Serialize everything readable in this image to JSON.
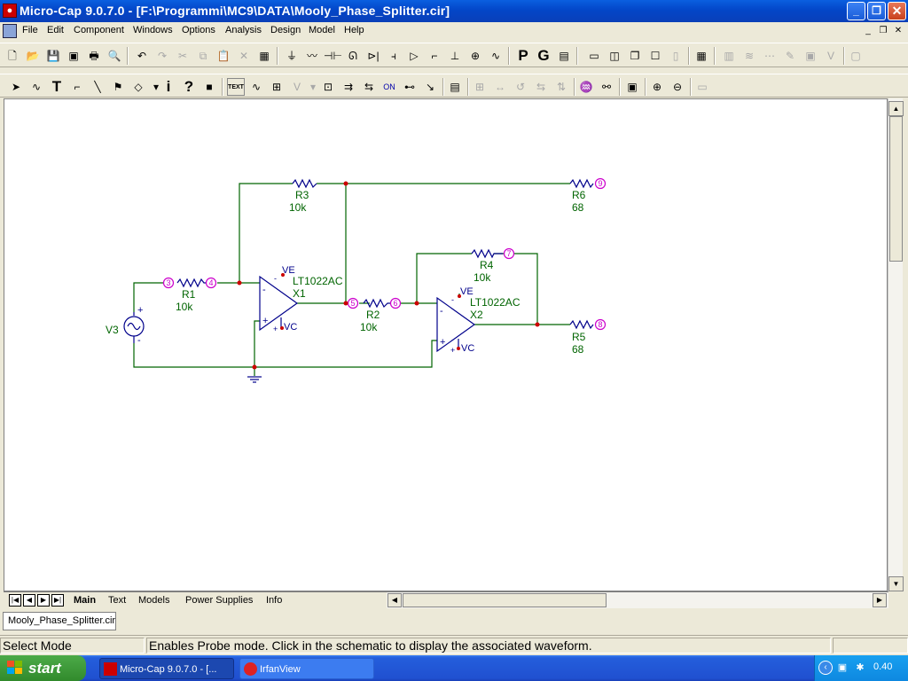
{
  "window": {
    "title": "Micro-Cap 9.0.7.0 - [F:\\Programmi\\MC9\\DATA\\Mooly_Phase_Splitter.cir]",
    "minimize": "_",
    "restore": "❐",
    "close": "✕"
  },
  "menu": {
    "items": [
      "File",
      "Edit",
      "Component",
      "Windows",
      "Options",
      "Analysis",
      "Design",
      "Model",
      "Help"
    ],
    "mdi_minimize": "_",
    "mdi_restore": "❐",
    "mdi_close": "✕"
  },
  "toolbar1": {
    "text_buttons": {
      "p": "P",
      "g": "G"
    }
  },
  "toolbar2": {
    "text_button": "TEXT",
    "info_button": "i",
    "help_button": "?"
  },
  "schematic": {
    "components": {
      "R1": {
        "name": "R1",
        "value": "10k"
      },
      "R2": {
        "name": "R2",
        "value": "10k"
      },
      "R3": {
        "name": "R3",
        "value": "10k"
      },
      "R4": {
        "name": "R4",
        "value": "10k"
      },
      "R5": {
        "name": "R5",
        "value": "68"
      },
      "R6": {
        "name": "R6",
        "value": "68"
      },
      "V3": {
        "name": "V3"
      },
      "X1": {
        "name": "X1",
        "model": "LT1022AC"
      },
      "X2": {
        "name": "X2",
        "model": "LT1022AC"
      }
    },
    "nodes": [
      "3",
      "4",
      "5",
      "6",
      "7",
      "8",
      "9"
    ],
    "pin_labels": {
      "ve": "VE",
      "vc": "VC",
      "plus": "+",
      "minus": "-"
    },
    "colors": {
      "wire": "#006400",
      "component": "#00008b",
      "label": "#006400",
      "node": "#cc00cc",
      "dot": "#cc0000"
    }
  },
  "sheet_tabs": [
    "Main",
    "Text",
    "Models",
    "Power Supplies",
    "Info"
  ],
  "active_sheet": "Main",
  "document_tab": "Mooly_Phase_Splitter.cir",
  "status": {
    "mode": "Select Mode",
    "message": "Enables Probe mode. Click in the schematic to display the associated waveform."
  },
  "taskbar": {
    "start": "start",
    "tasks": [
      {
        "label": "Micro-Cap 9.0.7.0 - [...",
        "active": true
      },
      {
        "label": "IrfanView",
        "active": false
      }
    ],
    "clock": "0.40"
  }
}
